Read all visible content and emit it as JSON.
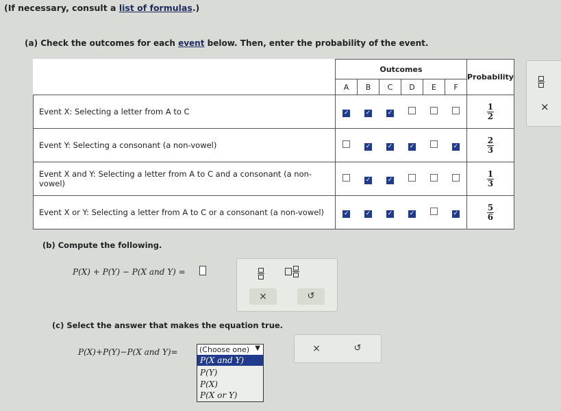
{
  "header": {
    "prefix": "(If necessary, consult a ",
    "link": "list of formulas",
    "suffix": ".)"
  },
  "part_a": {
    "prefix": "(a) Check the outcomes for each ",
    "link": "event",
    "suffix": " below. Then, enter the probability of the event."
  },
  "table": {
    "outcomes_label": "Outcomes",
    "probability_label": "Probability",
    "outcomes": [
      "A",
      "B",
      "C",
      "D",
      "E",
      "F"
    ],
    "rows": [
      {
        "event": "Event X: Selecting a letter from A to C",
        "checks": [
          true,
          true,
          true,
          false,
          false,
          false
        ],
        "num": "1",
        "den": "2"
      },
      {
        "event": "Event Y: Selecting a consonant (a non-vowel)",
        "checks": [
          false,
          true,
          true,
          true,
          false,
          true
        ],
        "num": "2",
        "den": "3"
      },
      {
        "event": "Event X and Y: Selecting a letter from A to C and a consonant (a non-vowel)",
        "checks": [
          false,
          true,
          true,
          false,
          false,
          false
        ],
        "num": "1",
        "den": "3"
      },
      {
        "event": "Event X or Y: Selecting a letter from A to C or a consonant (a non-vowel)",
        "checks": [
          true,
          true,
          true,
          true,
          false,
          true
        ],
        "num": "5",
        "den": "6"
      }
    ]
  },
  "side_tools": {
    "clear": "×"
  },
  "part_b": {
    "label": "(b) Compute the following.",
    "expr": "P(X) + P(Y) − P(X and Y) =",
    "clear": "×",
    "undo": "↺"
  },
  "part_c": {
    "label": "(c) Select the answer that makes the equation true.",
    "expr": "P(X)+P(Y)−P(X and Y)=",
    "select": "(Choose one)",
    "options": [
      "P(X and Y)",
      "P(Y)",
      "P(X)",
      "P(X or Y)"
    ],
    "clear": "×",
    "undo": "↺"
  },
  "colors": {
    "checked": "#203a8c",
    "highlight": "#203a8c",
    "background": "#d9dcd6"
  }
}
